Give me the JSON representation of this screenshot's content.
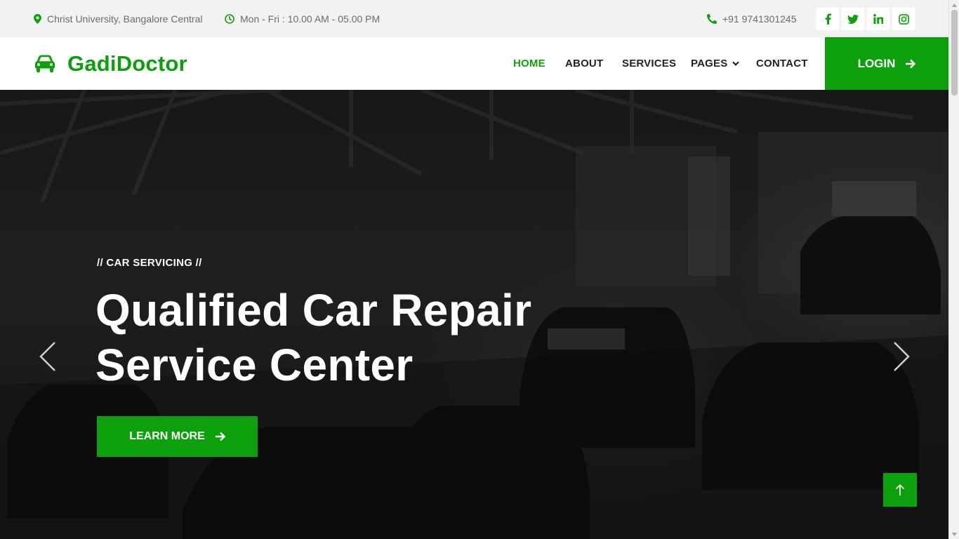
{
  "topbar": {
    "address": "Christ University, Bangalore Central",
    "hours": "Mon - Fri : 10.00 AM - 05.00 PM",
    "phone": "+91 9741301245",
    "social_icons": [
      "facebook-icon",
      "twitter-icon",
      "linkedin-icon",
      "instagram-icon"
    ]
  },
  "brand": {
    "name": "GadiDoctor",
    "icon": "car-icon"
  },
  "nav": {
    "items": [
      {
        "label": "HOME",
        "active": true
      },
      {
        "label": "ABOUT"
      },
      {
        "label": "SERVICES"
      },
      {
        "label": "PAGES",
        "dropdown": true
      },
      {
        "label": "CONTACT"
      }
    ],
    "login_label": "LOGIN"
  },
  "hero": {
    "eyebrow": "// CAR SERVICING //",
    "headline_line1": "Qualified Car Repair",
    "headline_line2": "Service Center",
    "cta_label": "LEARN MORE"
  },
  "colors": {
    "accent": "#0ca10c",
    "topbar_bg": "#f2f2f2",
    "text_dark": "#222222"
  }
}
